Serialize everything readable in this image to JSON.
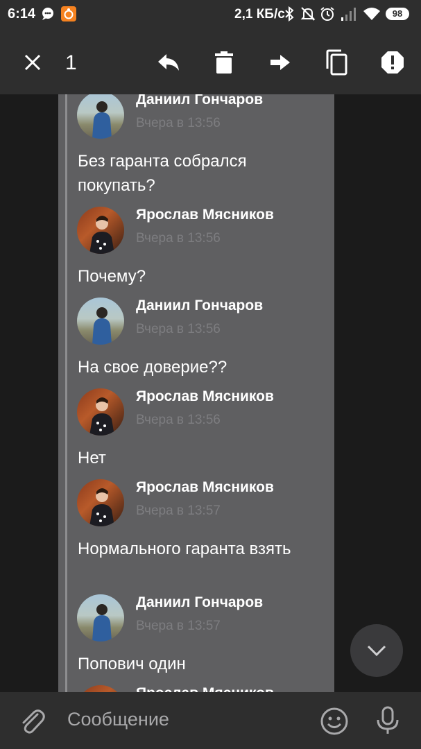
{
  "status_bar": {
    "time": "6:14",
    "network_speed": "2,1 КБ/с",
    "battery": "98"
  },
  "toolbar": {
    "selected_count": "1",
    "close_icon": "close-icon",
    "reply_icon": "reply-icon",
    "delete_icon": "trash-icon",
    "forward_icon": "forward-icon",
    "copy_icon": "copy-icon",
    "report_icon": "alert-icon"
  },
  "messages": [
    {
      "author": "Даниил Гончаров",
      "time": "Вчера в 13:56",
      "text": "Без гаранта собрался покупать?"
    },
    {
      "author": "Ярослав Мясников",
      "time": "Вчера в 13:56",
      "text": "Почему?"
    },
    {
      "author": "Даниил Гончаров",
      "time": "Вчера в 13:56",
      "text": "На свое доверие??"
    },
    {
      "author": "Ярослав Мясников",
      "time": "Вчера в 13:56",
      "text": "Нет"
    },
    {
      "author": "Ярослав Мясников",
      "time": "Вчера в 13:57",
      "text": "Нормального гаранта взять"
    },
    {
      "author": "Даниил Гончаров",
      "time": "Вчера в 13:57",
      "text": "Попович один"
    },
    {
      "author": "Ярослав Мясников",
      "time": "",
      "text": ""
    }
  ],
  "composer": {
    "placeholder": "Сообщение"
  },
  "colors": {
    "bar_bg": "#2e2e2e",
    "chat_bg": "#1b1b1b",
    "selection_bg": "#5f5f61",
    "muted_text": "#7d7d80"
  }
}
